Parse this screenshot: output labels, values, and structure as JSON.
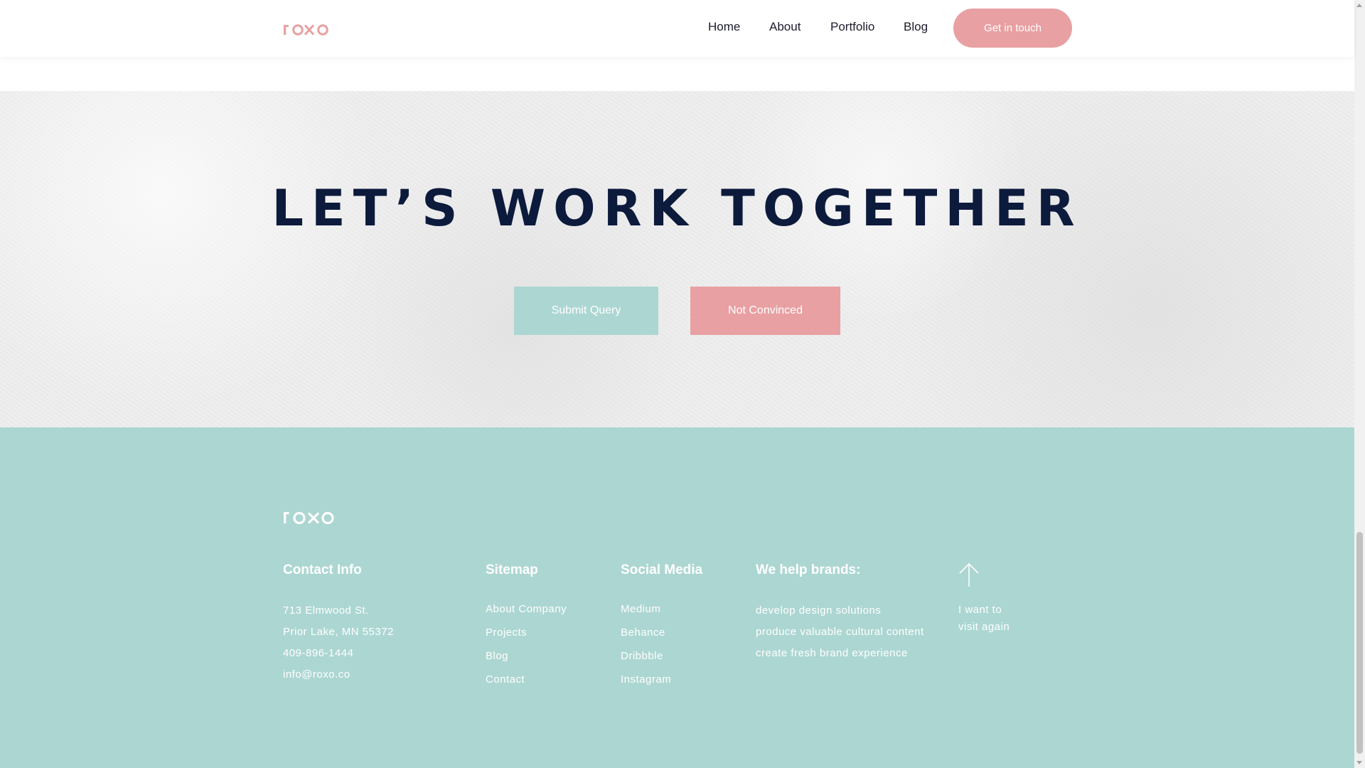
{
  "brand": {
    "logo_text": "roxo",
    "accent_pink": "#e8a0a2",
    "accent_teal": "#acd6d2",
    "navy": "#0c1a3c"
  },
  "header": {
    "nav": [
      {
        "label": "Home"
      },
      {
        "label": "About"
      },
      {
        "label": "Portfolio"
      },
      {
        "label": "Blog"
      }
    ],
    "cta_label": "Get in touch"
  },
  "hero": {
    "title": "LET’S WORK TOGETHER",
    "submit_label": "Submit Query",
    "not_convinced_label": "Not Convinced"
  },
  "footer": {
    "contact": {
      "heading": "Contact Info",
      "lines": [
        "713 Elmwood St.",
        "Prior Lake, MN 55372",
        "409-896-1444",
        "info@roxo.co"
      ]
    },
    "sitemap": {
      "heading": "Sitemap",
      "links": [
        "About Company",
        "Projects",
        "Blog",
        "Contact"
      ]
    },
    "social": {
      "heading": "Social Media",
      "links": [
        "Medium",
        "Behance",
        "Dribbble",
        "Instagram"
      ]
    },
    "brands": {
      "heading": "We help brands:",
      "lines": [
        "develop design solutions",
        "produce valuable cultural content",
        "create fresh brand experience"
      ]
    },
    "back_to_top": {
      "icon": "arrow-up-icon",
      "line1": "I want to",
      "line2": "visit again"
    }
  }
}
